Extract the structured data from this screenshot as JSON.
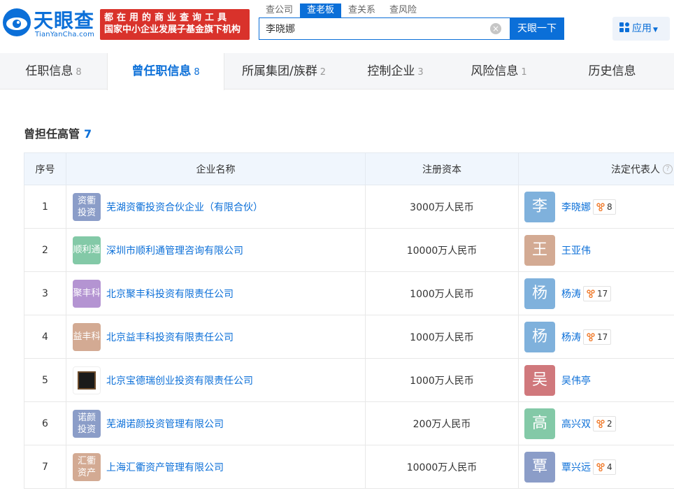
{
  "header": {
    "logo_text": "天眼查",
    "logo_sub": "TianYanCha.com",
    "promo_line1": "都在用的商业查询工具",
    "promo_line2": "国家中小企业发展子基金旗下机构",
    "search_tabs": [
      "查公司",
      "查老板",
      "查关系",
      "查风险"
    ],
    "active_search_tab": 1,
    "search_value": "李晓娜",
    "search_button": "天眼一下",
    "apps_label": "应用",
    "brand_color": "#0b6fd8"
  },
  "tabs": [
    {
      "label": "任职信息",
      "count": "8"
    },
    {
      "label": "曾任职信息",
      "count": "8"
    },
    {
      "label": "所属集团/族群",
      "count": "2"
    },
    {
      "label": "控制企业",
      "count": "3"
    },
    {
      "label": "风险信息",
      "count": "1"
    },
    {
      "label": "历史信息",
      "count": ""
    }
  ],
  "section": {
    "title": "曾担任高管",
    "count": "7",
    "columns": [
      "序号",
      "企业名称",
      "注册资本",
      "法定代表人"
    ]
  },
  "rows": [
    {
      "idx": "1",
      "logo_text": "资衢\n投资",
      "logo_color": "#8b9dc8",
      "company": "芜湖资衢投资合伙企业（有限合伙）",
      "capital": "3000万人民币",
      "rep_char": "李",
      "rep_color": "#7fb1dc",
      "rep": "李晓娜",
      "badge": "8"
    },
    {
      "idx": "2",
      "logo_text": "顺利通",
      "logo_color": "#83c9a7",
      "company": "深圳市顺利通管理咨询有限公司",
      "capital": "10000万人民币",
      "rep_char": "王",
      "rep_color": "#d3aa93",
      "rep": "王亚伟",
      "badge": ""
    },
    {
      "idx": "3",
      "logo_text": "聚丰科",
      "logo_color": "#b494d2",
      "company": "北京聚丰科投资有限责任公司",
      "capital": "1000万人民币",
      "rep_char": "杨",
      "rep_color": "#7fb1dc",
      "rep": "杨涛",
      "badge": "17"
    },
    {
      "idx": "4",
      "logo_text": "益丰科",
      "logo_color": "#d3aa93",
      "company": "北京益丰科投资有限责任公司",
      "capital": "1000万人民币",
      "rep_char": "杨",
      "rep_color": "#7fb1dc",
      "rep": "杨涛",
      "badge": "17"
    },
    {
      "idx": "5",
      "logo_text": "",
      "logo_color": "image",
      "company": "北京宝德瑞创业投资有限责任公司",
      "capital": "1000万人民币",
      "rep_char": "吴",
      "rep_color": "#d0787c",
      "rep": "吴伟亭",
      "badge": ""
    },
    {
      "idx": "6",
      "logo_text": "诺颜\n投资",
      "logo_color": "#8b9dc8",
      "company": "芜湖诺颜投资管理有限公司",
      "capital": "200万人民币",
      "rep_char": "高",
      "rep_color": "#83c9a7",
      "rep": "高兴双",
      "badge": "2"
    },
    {
      "idx": "7",
      "logo_text": "汇衢\n资产",
      "logo_color": "#d3aa93",
      "company": "上海汇衢资产管理有限公司",
      "capital": "10000万人民币",
      "rep_char": "覃",
      "rep_color": "#8b9dc8",
      "rep": "覃兴远",
      "badge": "4"
    }
  ]
}
